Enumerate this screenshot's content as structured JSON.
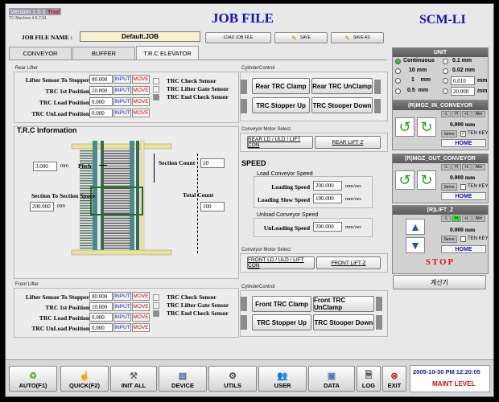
{
  "header": {
    "version": "Version 1.0.1",
    "trial": "Trial",
    "machine": "TC-Machine 4.5.7.91",
    "title": "JOB FILE",
    "brand": "SCM-LI"
  },
  "jobfile": {
    "label": "JOB FILE NAME :",
    "name": "Default.JOB",
    "load": "LOAD JOB FILE",
    "save": "SAVE",
    "save_as": "SAVE AS"
  },
  "tabs": [
    "CONVEYOR",
    "BUFFER",
    "T.R.C ELEVATOR"
  ],
  "rear_lifter": {
    "title": "Rear Lifter",
    "rows": [
      {
        "label": "Lifter Sensor To Stopper",
        "value": "80.000"
      },
      {
        "label": "TRC 1st Position",
        "value": "10.000"
      },
      {
        "label": "TRC Load Position",
        "value": "0.000"
      },
      {
        "label": "TRC UnLoad Position",
        "value": "0.000"
      }
    ],
    "input": "INPUT",
    "move": "MOVE",
    "sensors": [
      "TRC Check Sensor",
      "TRC Lifter Gate Sensor",
      "TRC End Check Sensor"
    ]
  },
  "cyl_top": {
    "title": "CylinderControl",
    "b1": "Rear TRC Clamp",
    "b2": "Rear TRC UnClamp",
    "b3": "TRC Stopper Up",
    "b4": "TRC Stooper Down"
  },
  "trc_info": {
    "title": "T.R.C Information",
    "pitch_val": "3.000",
    "pitch_unit": "mm",
    "pitch": "Pitch",
    "section_count": "Section Count",
    "section_count_val": "10",
    "sts_label": "Section To Section Space",
    "sts_val": "200.000",
    "sts_unit": "mm",
    "total_count": "Total Count",
    "total_count_val": "100"
  },
  "conv_motor_top": {
    "title": "Conveyor Motor Select",
    "b1": "REAR LD / ULD / LIFT CON",
    "b2": "REAR LIFT Z"
  },
  "speed": {
    "title": "SPEED",
    "load_title": "Load  Conveyor Speed",
    "loading_speed": "Loading Speed",
    "loading_speed_val": "200.000",
    "loading_slow": "Loading Slow Speed",
    "loading_slow_val": "100.000",
    "unload_title": "Unload Conveyor Speed",
    "unloading_speed": "UnLoading Speed",
    "unloading_speed_val": "200.000",
    "unit": "mm/sec"
  },
  "conv_motor_bot": {
    "title": "Conveyor Motor Select",
    "b1": "FRONT LD / ULD / LIFT CON",
    "b2": "FRONT LIFT Z"
  },
  "front_lifter": {
    "title": "Front Lifter",
    "rows": [
      {
        "label": "Lifter Sensor To Stopper",
        "value": "80.000"
      },
      {
        "label": "TRC 1st Position",
        "value": "10.000"
      },
      {
        "label": "TRC Load Position",
        "value": "0.000"
      },
      {
        "label": "TRC UnLoad Position",
        "value": "0.000"
      }
    ],
    "sensors": [
      "TRC Check Sensor",
      "TRC Lifter Gate Sensor",
      "TRC End Check Sensor"
    ]
  },
  "cyl_bot": {
    "title": "CylinderControl",
    "b1": "Front TRC Clamp",
    "b2": "Front TRC UnClamp",
    "b3": "TRC Stopper Up",
    "b4": "TRC Stooper Down"
  },
  "unit_panel": {
    "title": "UNIT",
    "continuous": "Continuous",
    "u01": "0.1 mm",
    "u10": "10 mm",
    "u002": "0.02 mm",
    "u1": "1    mm",
    "u0010": "0.010",
    "mm": "mm",
    "u05": "0.5  mm",
    "u20": "20.000"
  },
  "axes": [
    {
      "title": "(R)MGZ_IN_CONVEYOR",
      "value": "0.000 mm",
      "servo": "Servo",
      "tenkey": "TEN KEY",
      "home": "HOME"
    },
    {
      "title": "(R)MGZ_OUT_CONVEYOR",
      "value": "0.000 mm",
      "servo": "Servo",
      "tenkey": "TEN KEY",
      "home": "HOME"
    },
    {
      "title": "(R)LIFT_Z",
      "value": "0.000 mm",
      "servo": "Servo",
      "tenkey": "TEN KEY",
      "home": "HOME"
    }
  ],
  "flags": [
    "-L",
    "H",
    "+L",
    "Alm"
  ],
  "stop": "STOP",
  "calc": "계산기",
  "footer": {
    "buttons": [
      "AUTO(F1)",
      "QUICK(F2)",
      "INIT ALL",
      "DEVICE",
      "UTILS",
      "USER",
      "DATA",
      "LOG",
      "EXIT"
    ],
    "datetime": "2009-10-30 PM 12:20:05",
    "level": "MAINT LEVEL"
  },
  "colors": {
    "title_blue": "#1010c8",
    "move_red": "#d01010",
    "input_blue": "#1020c0",
    "stop_red": "#d81818"
  }
}
